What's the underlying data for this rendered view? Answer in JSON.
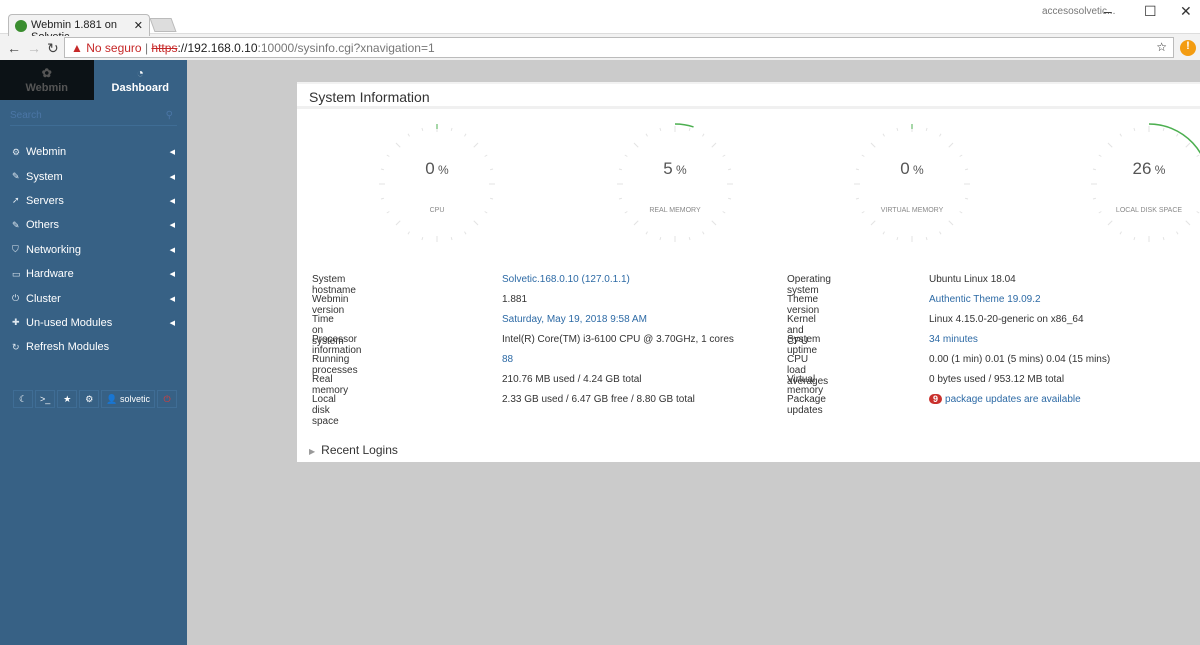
{
  "browser": {
    "tab_title": "Webmin 1.881 on Solvetic",
    "profile": "accesosolvetic...",
    "not_secure": "No seguro",
    "url_scheme": "https",
    "url_host": "://192.168.0.10",
    "url_rest": ":10000/sysinfo.cgi?xnavigation=1"
  },
  "sidebar": {
    "tabs": [
      {
        "label": "Webmin",
        "icon": "webmin-logo"
      },
      {
        "label": "Dashboard",
        "icon": "dashboard-icon"
      }
    ],
    "search_placeholder": "Search",
    "items": [
      {
        "label": "Webmin",
        "icon": "gear"
      },
      {
        "label": "System",
        "icon": "wrench"
      },
      {
        "label": "Servers",
        "icon": "rocket"
      },
      {
        "label": "Others",
        "icon": "wrench"
      },
      {
        "label": "Networking",
        "icon": "shield"
      },
      {
        "label": "Hardware",
        "icon": "hdd"
      },
      {
        "label": "Cluster",
        "icon": "power"
      },
      {
        "label": "Un-used Modules",
        "icon": "puzzle"
      },
      {
        "label": "Refresh Modules",
        "icon": "refresh"
      }
    ],
    "user": "solvetic"
  },
  "main": {
    "title": "System Information",
    "gauges": [
      {
        "label": "CPU",
        "percent": 0
      },
      {
        "label": "REAL MEMORY",
        "percent": 5
      },
      {
        "label": "VIRTUAL MEMORY",
        "percent": 0
      },
      {
        "label": "LOCAL DISK SPACE",
        "percent": 26
      }
    ],
    "gauge_color": "#4caf50",
    "left": [
      {
        "k": "System hostname",
        "v": "Solvetic.168.0.10 (127.0.1.1)",
        "link": true
      },
      {
        "k": "Webmin version",
        "v": "1.881"
      },
      {
        "k": "Time on system",
        "v": "Saturday, May 19, 2018 9:58 AM",
        "link": true
      },
      {
        "k": "Processor information",
        "v": "Intel(R) Core(TM) i3-6100 CPU @ 3.70GHz, 1 cores"
      },
      {
        "k": "Running processes",
        "v": "88",
        "link": true
      },
      {
        "k": "Real memory",
        "v": "210.76 MB used / 4.24 GB total"
      },
      {
        "k": "Local disk space",
        "v": "2.33 GB used / 6.47 GB free / 8.80 GB total"
      }
    ],
    "right": [
      {
        "k": "Operating system",
        "v": "Ubuntu Linux 18.04"
      },
      {
        "k": "Theme version",
        "v": "Authentic Theme 19.09.2",
        "link": true
      },
      {
        "k": "Kernel and CPU",
        "v": "Linux 4.15.0-20-generic on x86_64"
      },
      {
        "k": "System uptime",
        "v": "34 minutes",
        "link": true
      },
      {
        "k": "CPU load averages",
        "v": "0.00 (1 min) 0.01 (5 mins) 0.04 (15 mins)"
      },
      {
        "k": "Virtual memory",
        "v": "0 bytes used / 953.12 MB total"
      },
      {
        "k": "Package updates",
        "v": "package updates are available",
        "link": true,
        "badge": "9"
      }
    ],
    "recent_logins": "Recent Logins"
  }
}
